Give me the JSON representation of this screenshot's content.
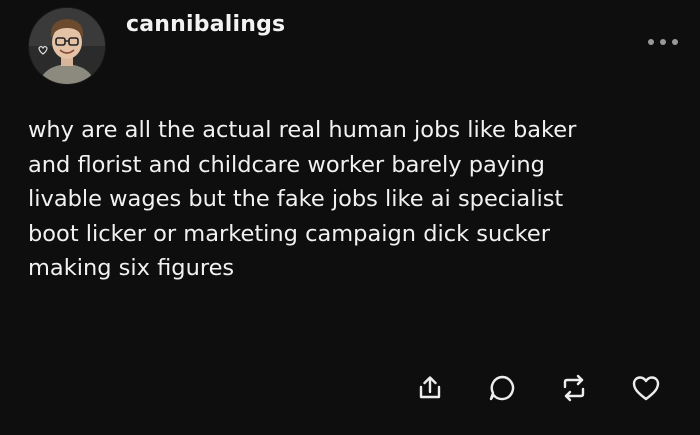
{
  "post": {
    "username": "cannibalings",
    "body": "why are all the actual real human jobs like baker\nand florist and childcare worker barely paying\nlivable wages but the fake jobs like ai specialist\nboot licker or marketing campaign dick sucker\nmaking six figures"
  },
  "icons": {
    "more": "more-options-icon",
    "share": "share-icon",
    "reply": "reply-icon",
    "reblog": "reblog-icon",
    "like": "heart-icon"
  },
  "colors": {
    "background": "#0e0e0e",
    "text": "#f1f1f1",
    "muted": "#9a9a9a"
  }
}
